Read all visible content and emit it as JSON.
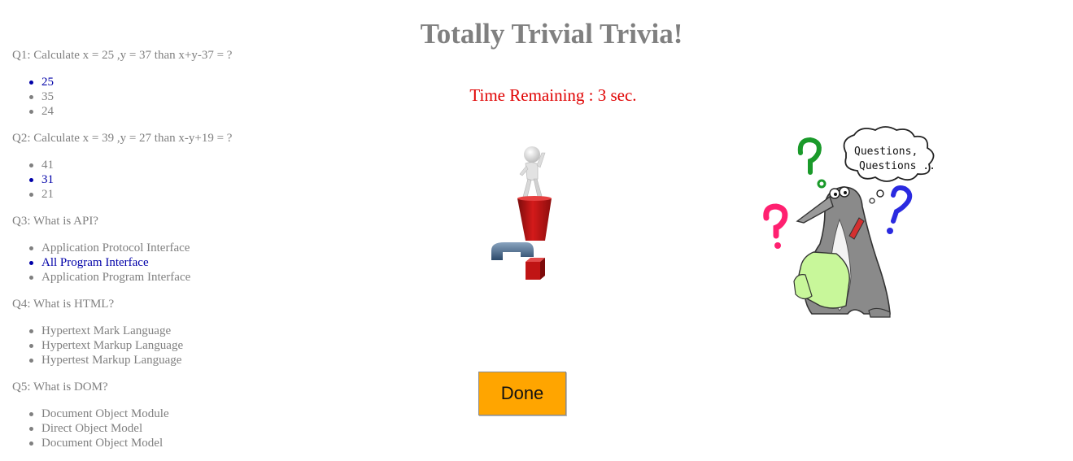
{
  "title": "Totally Trivial Trivia!",
  "timer": {
    "label": "Time Remaining : 3 sec."
  },
  "done_label": "Done",
  "colors": {
    "heading": "#808080",
    "timer": "#e00000",
    "selected_answer": "#0000a8",
    "done_button": "#ffa500"
  },
  "questions": [
    {
      "text": "Q1: Calculate x = 25 ,y = 37 than x+y-37 = ?",
      "answers": [
        {
          "text": "25",
          "selected": true
        },
        {
          "text": "35",
          "selected": false
        },
        {
          "text": "24",
          "selected": false
        }
      ]
    },
    {
      "text": "Q2: Calculate x = 39 ,y = 27 than x-y+19 = ?",
      "answers": [
        {
          "text": "41",
          "selected": false
        },
        {
          "text": "31",
          "selected": true
        },
        {
          "text": "21",
          "selected": false
        }
      ]
    },
    {
      "text": "Q3: What is API?",
      "answers": [
        {
          "text": "Application Protocol Interface",
          "selected": false
        },
        {
          "text": "All Program Interface",
          "selected": true
        },
        {
          "text": "Application Program Interface",
          "selected": false
        }
      ]
    },
    {
      "text": "Q4: What is HTML?",
      "answers": [
        {
          "text": "Hypertext Mark Language",
          "selected": false
        },
        {
          "text": "Hypertext Markup Language",
          "selected": false
        },
        {
          "text": "Hypertest Markup Language",
          "selected": false
        }
      ]
    },
    {
      "text": "Q5: What is DOM?",
      "answers": [
        {
          "text": "Document Object Module",
          "selected": false
        },
        {
          "text": "Direct Object Model",
          "selected": false
        },
        {
          "text": "Document Object Model",
          "selected": false
        }
      ]
    }
  ],
  "images": {
    "left": "exclamation-question-figure-icon",
    "right": "penguin-questions-icon",
    "thought_bubble": "Questions, Questions .."
  }
}
